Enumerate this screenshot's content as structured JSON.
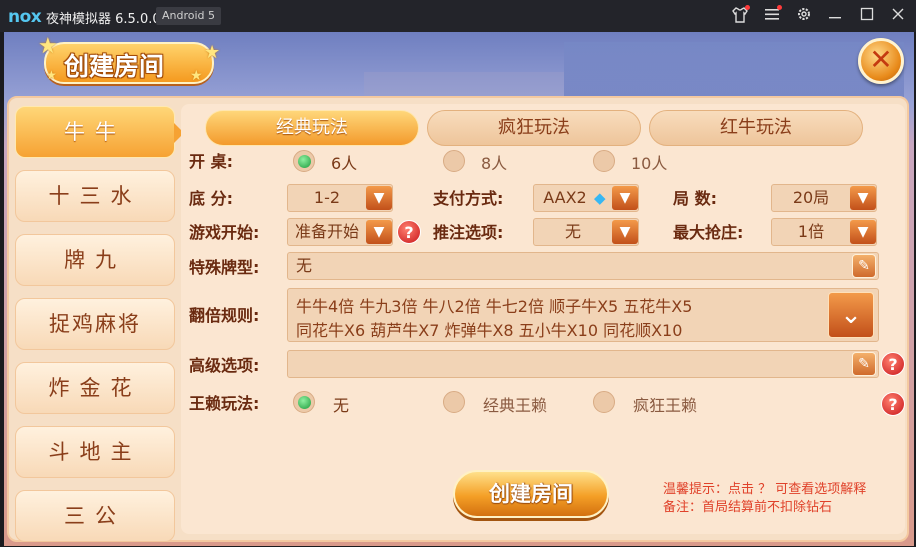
{
  "titlebar": {
    "logo": "nox",
    "app_name": "夜神模拟器 6.5.0.0",
    "android_badge": "Android 5",
    "icons": [
      "shirt-icon",
      "menu-icon",
      "settings-icon",
      "minimize-icon",
      "maximize-icon",
      "close-icon"
    ]
  },
  "header": {
    "title": "创建房间"
  },
  "sidebar": {
    "items": [
      {
        "label": "牛牛",
        "active": true
      },
      {
        "label": "十三水",
        "active": false
      },
      {
        "label": "牌九",
        "active": false
      },
      {
        "label": "捉鸡麻将",
        "active": false
      },
      {
        "label": "炸金花",
        "active": false
      },
      {
        "label": "斗地主",
        "active": false
      },
      {
        "label": "三公",
        "active": false
      }
    ]
  },
  "tabs": [
    {
      "label": "经典玩法",
      "active": true
    },
    {
      "label": "疯狂玩法",
      "active": false
    },
    {
      "label": "红牛玩法",
      "active": false
    }
  ],
  "form": {
    "open_table": {
      "label": "开  桌:",
      "options": [
        "6人",
        "8人",
        "10人"
      ],
      "selected": "6人"
    },
    "base_score": {
      "label": "底  分:",
      "value": "1-2"
    },
    "payment": {
      "label": "支付方式:",
      "value": "AAX2"
    },
    "rounds": {
      "label": "局  数:",
      "value": "20局"
    },
    "game_start": {
      "label": "游戏开始:",
      "value": "准备开始"
    },
    "bet_option": {
      "label": "推注选项:",
      "value": "无"
    },
    "max_grab": {
      "label": "最大抢庄:",
      "value": "1倍"
    },
    "special_cards": {
      "label": "特殊牌型:",
      "value": "无"
    },
    "multiplier_rules": {
      "label": "翻倍规则:",
      "line1": "牛牛4倍 牛九3倍 牛八2倍 牛七2倍 顺子牛X5 五花牛X5",
      "line2": "同花牛X6 葫芦牛X7 炸弹牛X8 五小牛X10 同花顺X10"
    },
    "advanced": {
      "label": "高级选项:",
      "value": ""
    },
    "wildcard": {
      "label": "王赖玩法:",
      "options": [
        "无",
        "经典王赖",
        "疯狂王赖"
      ],
      "selected": "无"
    }
  },
  "actions": {
    "create_label": "创建房间"
  },
  "tips": {
    "line1": "温馨提示：点击 ？ 可查看选项解释",
    "line2": "备注：首局结算前不扣除钻石"
  },
  "colors": {
    "accent_orange": "#f39a2c",
    "panel_bg": "#f6dfc6",
    "label_brown": "#6a2a10",
    "tip_red": "#e0422a"
  }
}
